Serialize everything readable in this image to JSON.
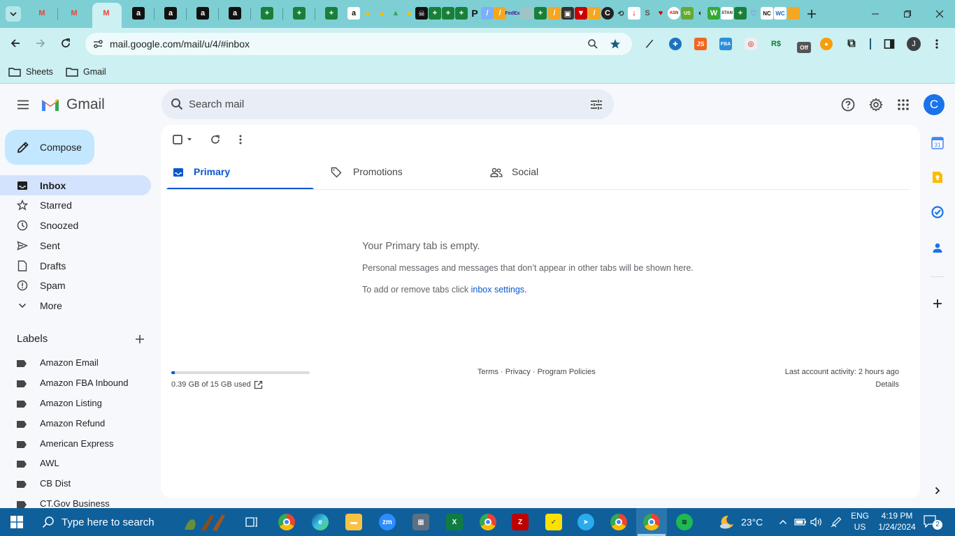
{
  "browser": {
    "url": "mail.google.com/mail/u/4/#inbox",
    "bookmarks": [
      {
        "label": "Sheets"
      },
      {
        "label": "Gmail"
      }
    ],
    "profile_initial": "J"
  },
  "gmail": {
    "app_name": "Gmail",
    "compose_label": "Compose",
    "search_placeholder": "Search mail",
    "account_initial": "C",
    "nav": [
      {
        "label": "Inbox",
        "icon": "inbox-icon",
        "active": true
      },
      {
        "label": "Starred",
        "icon": "star-icon"
      },
      {
        "label": "Snoozed",
        "icon": "clock-icon"
      },
      {
        "label": "Sent",
        "icon": "send-icon"
      },
      {
        "label": "Drafts",
        "icon": "draft-icon"
      },
      {
        "label": "Spam",
        "icon": "spam-icon"
      },
      {
        "label": "More",
        "icon": "chevron-down-icon"
      }
    ],
    "labels_heading": "Labels",
    "labels": [
      "Amazon Email",
      "Amazon FBA Inbound",
      "Amazon Listing",
      "Amazon Refund",
      "American Express",
      "AWL",
      "CB Dist",
      "CT.Gov Business"
    ],
    "tabs": [
      {
        "label": "Primary",
        "icon": "inbox-icon",
        "active": true
      },
      {
        "label": "Promotions",
        "icon": "tag-icon"
      },
      {
        "label": "Social",
        "icon": "people-icon"
      }
    ],
    "empty_state": {
      "title": "Your Primary tab is empty.",
      "line1": "Personal messages and messages that don’t appear in other tabs will be shown here.",
      "line2_prefix": "To add or remove tabs click ",
      "line2_link": "inbox settings",
      "line2_suffix": "."
    },
    "footer": {
      "storage_text": "0.39 GB of 15 GB used",
      "storage_fraction": 0.026,
      "terms": "Terms",
      "privacy": "Privacy",
      "policies": "Program Policies",
      "sep": " · ",
      "activity": "Last account activity: 2 hours ago",
      "details": "Details"
    }
  },
  "taskbar": {
    "search_placeholder": "Type here to search",
    "weather": "23°C",
    "lang1": "ENG",
    "lang2": "US",
    "time": "4:19 PM",
    "date": "1/24/2024",
    "notifications": "2"
  },
  "colors": {
    "chrome_tab_strip": "#7dcfd4",
    "chrome_toolbar": "#cdf0f2",
    "gmail_bg": "#f6f8fc",
    "compose_bg": "#c2e7ff",
    "inbox_active": "#d3e3fd",
    "accent_blue": "#0b57d0",
    "taskbar": "#0f5f9a"
  }
}
